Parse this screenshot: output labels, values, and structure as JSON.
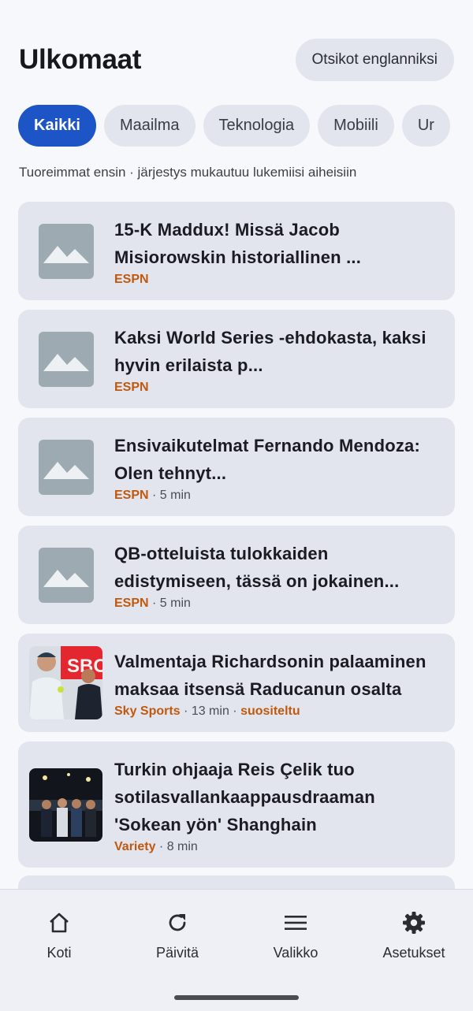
{
  "header": {
    "title": "Ulkomaat",
    "translate_button": "Otsikot englanniksi"
  },
  "chips": [
    "Kaikki",
    "Maailma",
    "Teknologia",
    "Mobiili",
    "Ur"
  ],
  "subtitle": "Tuoreimmat ensin · järjestys mukautuu lukemiisi aiheisiin",
  "articles": [
    {
      "title": "15-K Maddux! Missä Jacob Misiorowskin historiallinen ...",
      "source": "ESPN",
      "time": "",
      "tag": "",
      "thumb": "placeholder-image-icon"
    },
    {
      "title": "Kaksi World Series -ehdokasta, kaksi hyvin erilaista p...",
      "source": "ESPN",
      "time": "",
      "tag": "",
      "thumb": "placeholder-image-icon"
    },
    {
      "title": "Ensivaikutelmat Fernando Mendoza: Olen tehnyt...",
      "source": "ESPN",
      "time": "5 min",
      "tag": "",
      "thumb": "placeholder-image-icon"
    },
    {
      "title": "QB-otteluista tulokkaiden edistymiseen, tässä on jokainen...",
      "source": "ESPN",
      "time": "5 min",
      "tag": "",
      "thumb": "placeholder-image-icon"
    },
    {
      "title": "Valmentaja Richardsonin palaaminen maksaa itsensä Raducanun osalta",
      "source": "Sky Sports",
      "time": "13 min",
      "tag": "suositeltu",
      "thumb": "tennis-photo"
    },
    {
      "title": "Turkin ohjaaja Reis Çelik tuo sotilasvallankaappausdraaman 'Sokean yön' Shanghain",
      "source": "Variety",
      "time": "8 min",
      "tag": "",
      "thumb": "premiere-photo"
    }
  ],
  "photo_text": {
    "tennis_banner": "SBC"
  },
  "nav": [
    {
      "label": "Koti",
      "icon": "home-icon"
    },
    {
      "label": "Päivitä",
      "icon": "refresh-icon"
    },
    {
      "label": "Valikko",
      "icon": "menu-icon"
    },
    {
      "label": "Asetukset",
      "icon": "settings-icon"
    }
  ],
  "colors": {
    "accent": "#1d55c6",
    "source": "#c0590e",
    "card": "#e2e5ee",
    "background": "#f7f8fb"
  }
}
